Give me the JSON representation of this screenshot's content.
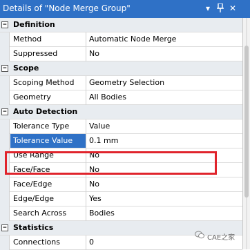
{
  "window": {
    "title": "Details of \"Node Merge Group\"",
    "controls": {
      "dropdown": "▾",
      "pin": "📌",
      "close": "✕"
    }
  },
  "sections": [
    {
      "title": "Definition",
      "rows": [
        {
          "label": "Method",
          "value": "Automatic Node Merge"
        },
        {
          "label": "Suppressed",
          "value": "No"
        }
      ]
    },
    {
      "title": "Scope",
      "rows": [
        {
          "label": "Scoping Method",
          "value": "Geometry Selection"
        },
        {
          "label": "Geometry",
          "value": "All Bodies"
        }
      ]
    },
    {
      "title": "Auto Detection",
      "rows": [
        {
          "label": "Tolerance Type",
          "value": "Value"
        },
        {
          "label": "Tolerance Value",
          "value": "0.1 mm"
        },
        {
          "label": "Use Range",
          "value": "No"
        },
        {
          "label": "Face/Face",
          "value": "No"
        },
        {
          "label": "Face/Edge",
          "value": "No"
        },
        {
          "label": "Edge/Edge",
          "value": "Yes"
        },
        {
          "label": "Search Across",
          "value": "Bodies"
        }
      ]
    },
    {
      "title": "Statistics",
      "rows": [
        {
          "label": "Connections",
          "value": "0"
        }
      ]
    }
  ],
  "expander": "−",
  "watermark": "CAE之家",
  "colors": {
    "titlebar": "#2f71c6",
    "selection": "#2f71c6",
    "group_bg": "#e8ecf0",
    "highlight_border": "#e0242c"
  }
}
